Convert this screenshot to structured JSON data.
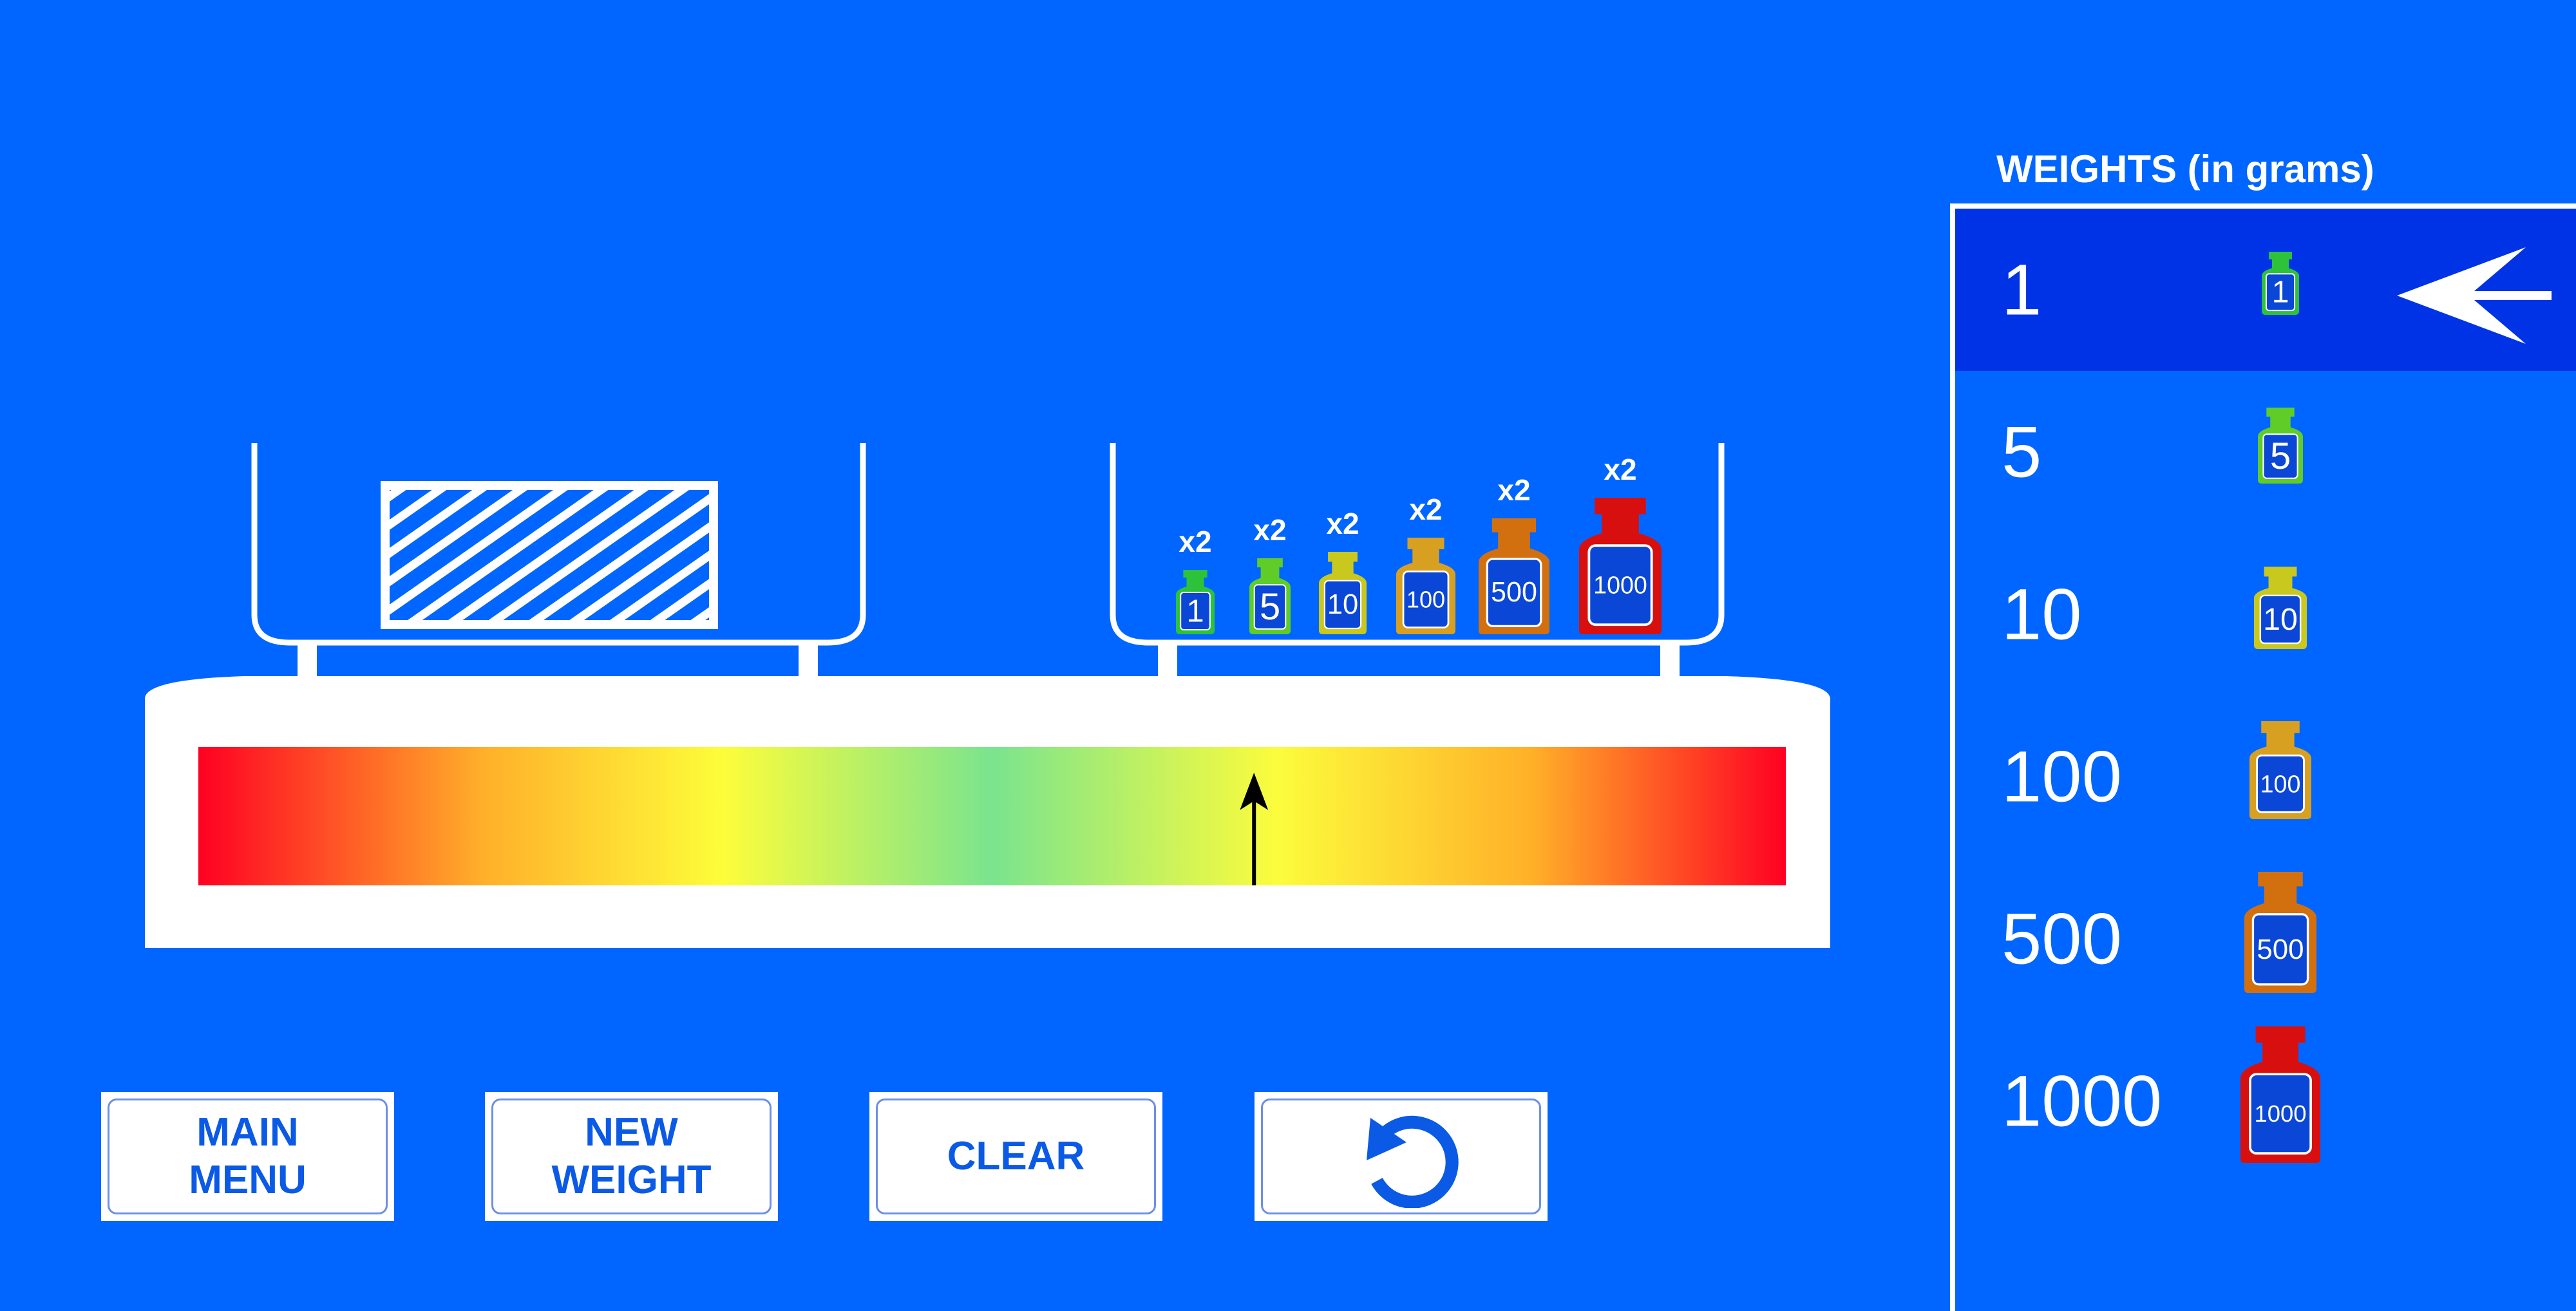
{
  "panel": {
    "title": "WEIGHTS (in grams)",
    "selected_index": 0,
    "items": [
      {
        "label": "1",
        "color": "#2ec23a"
      },
      {
        "label": "5",
        "color": "#5fcc28"
      },
      {
        "label": "10",
        "color": "#c8c81e"
      },
      {
        "label": "100",
        "color": "#d8a020"
      },
      {
        "label": "500",
        "color": "#d2700f"
      },
      {
        "label": "1000",
        "color": "#d80f0f"
      }
    ]
  },
  "pan_weights": [
    {
      "label": "1",
      "count": "x2",
      "color": "#2ec23a"
    },
    {
      "label": "5",
      "count": "x2",
      "color": "#5fcc28"
    },
    {
      "label": "10",
      "count": "x2",
      "color": "#c8c81e"
    },
    {
      "label": "100",
      "count": "x2",
      "color": "#d8a020"
    },
    {
      "label": "500",
      "count": "x2",
      "color": "#d2700f"
    },
    {
      "label": "1000",
      "count": "x2",
      "color": "#d80f0f"
    }
  ],
  "buttons": {
    "main_menu": [
      "MAIN",
      "MENU"
    ],
    "new_weight": [
      "NEW",
      "WEIGHT"
    ],
    "clear": "CLEAR",
    "undo_icon": "undo-icon"
  },
  "indicator": {
    "position_fraction": 0.665
  },
  "colors": {
    "background": "#0066ff",
    "selected_row": "#0033e6",
    "button_text": "#0a5ae6"
  }
}
